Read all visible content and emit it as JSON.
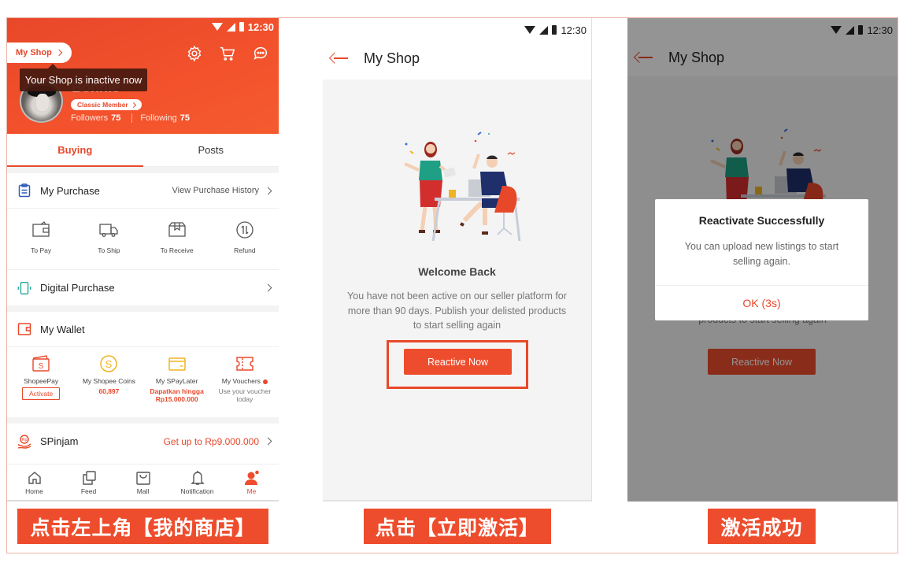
{
  "colors": {
    "accent": "#ee4d2d",
    "header": "#f3522c",
    "tooltip": "#46190f",
    "frame": "#eab3a6"
  },
  "status_bar": {
    "time": "12:30",
    "icons": [
      "wifi-icon",
      "cell-signal-icon",
      "battery-icon"
    ]
  },
  "panel1": {
    "my_shop_label": "My Shop",
    "tooltip": "Your Shop is inactive now",
    "header_icons": [
      "gear-icon",
      "cart-icon",
      "chat-icon"
    ],
    "username": "Bonnie",
    "member_badge": "Classic Member",
    "followers_label": "Followers",
    "followers_count": "75",
    "following_label": "Following",
    "following_count": "75",
    "tabs": [
      {
        "label": "Buying",
        "active": true
      },
      {
        "label": "Posts",
        "active": false
      }
    ],
    "my_purchase": {
      "label": "My Purchase",
      "right": "View Purchase History"
    },
    "purchase_items": [
      {
        "label": "To Pay",
        "icon": "wallet-icon"
      },
      {
        "label": "To Ship",
        "icon": "truck-icon"
      },
      {
        "label": "To Receive",
        "icon": "box-icon"
      },
      {
        "label": "Refund",
        "icon": "refund-icon"
      }
    ],
    "digital_purchase": {
      "label": "Digital Purchase"
    },
    "my_wallet": {
      "label": "My Wallet"
    },
    "wallet_items": [
      {
        "label": "ShopeePay",
        "action": "Activate"
      },
      {
        "label": "My Shopee Coins",
        "sub": "60,897"
      },
      {
        "label": "My SPayLater",
        "sub1": "Dapatkan hingga",
        "sub2": "Rp15.000.000"
      },
      {
        "label": "My Vouchers",
        "sub1": "Use your voucher",
        "sub2": "today",
        "has_dot": true
      }
    ],
    "spinjam": {
      "label": "SPinjam",
      "right": "Get up to Rp9.000.000"
    },
    "bottom_nav": [
      {
        "label": "Home",
        "active": false
      },
      {
        "label": "Feed",
        "active": false
      },
      {
        "label": "Mall",
        "active": false
      },
      {
        "label": "Notification",
        "active": false
      },
      {
        "label": "Me",
        "active": true
      }
    ]
  },
  "panel2": {
    "title": "My Shop",
    "welcome_title": "Welcome Back",
    "welcome_desc": "You have not been active on our seller platform for more than 90 days. Publish your delisted products to start selling again",
    "button": "Reactive Now"
  },
  "panel3": {
    "title": "My Shop",
    "dialog_title": "Reactivate Successfully",
    "dialog_body": "You can upload new listings to start selling again.",
    "dialog_ok": "OK (3s)",
    "behind_text": "products to start selling again",
    "button": "Reactive Now"
  },
  "captions": [
    "点击左上角【我的商店】",
    "点击【立即激活】",
    "激活成功"
  ]
}
